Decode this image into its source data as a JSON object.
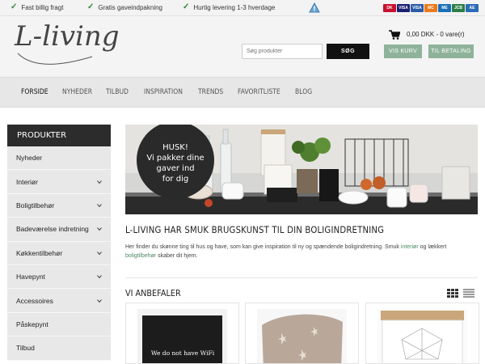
{
  "topbar": {
    "usps": [
      "Fast billig fragt",
      "Gratis gaveindpakning",
      "Hurtig levering 1-3 hverdage"
    ],
    "card_icons": [
      "dankort-icon",
      "visa-icon",
      "visa-electron-icon",
      "mastercard-icon",
      "maestro-icon",
      "jcb-icon",
      "amex-icon"
    ],
    "card_labels": [
      "DK",
      "VISA",
      "VISA",
      "MC",
      "ME",
      "JCB",
      "AE"
    ]
  },
  "header": {
    "logo": "L-living",
    "search_placeholder": "Søg produkter",
    "search_button": "SØG",
    "cart_summary": "0,00 DKK - 0 vare(r)",
    "view_cart": "VIS KURV",
    "checkout": "TIL BETALING"
  },
  "nav": {
    "items": [
      "FORSIDE",
      "NYHEDER",
      "TILBUD",
      "INSPIRATION",
      "TRENDS",
      "FAVORITLISTE",
      "BLOG"
    ]
  },
  "sidebar": {
    "title": "PRODUKTER",
    "items": [
      {
        "label": "Nyheder",
        "chevron": false
      },
      {
        "label": "Interiør",
        "chevron": true
      },
      {
        "label": "Boligtilbehør",
        "chevron": true
      },
      {
        "label": "Badeværelse indretning",
        "chevron": true
      },
      {
        "label": "Køkkentilbehør",
        "chevron": true
      },
      {
        "label": "Havepynt",
        "chevron": true
      },
      {
        "label": "Accessoires",
        "chevron": true
      },
      {
        "label": "Påskepynt",
        "chevron": false
      },
      {
        "label": "Tilbud",
        "chevron": false
      }
    ]
  },
  "hero": {
    "badge": [
      "HUSK!",
      "Vi pakker dine",
      "gaver ind",
      "for dig"
    ]
  },
  "main": {
    "title": "L-LIVING HAR SMUK BRUGSKUNST TIL DIN BOLIGINDRETNING",
    "text_1": "Her finder du skønne ting til hus og have, som kan give inspiration til ny og spændende boligindretning. Smuk ",
    "link_1": "interiør",
    "text_2": " og lækkert ",
    "link_2": "boligtilbehør",
    "text_3": " skaber dit hjem.",
    "recommend_title": "VI ANBEFALER",
    "products": [
      {
        "caption": "We do not have WiFi"
      },
      {
        "caption": ""
      },
      {
        "caption": ""
      }
    ]
  },
  "colors": {
    "accent_green": "#8fb39a",
    "link_green": "#4f8a64",
    "sidebar_header": "#2c2c2c"
  }
}
